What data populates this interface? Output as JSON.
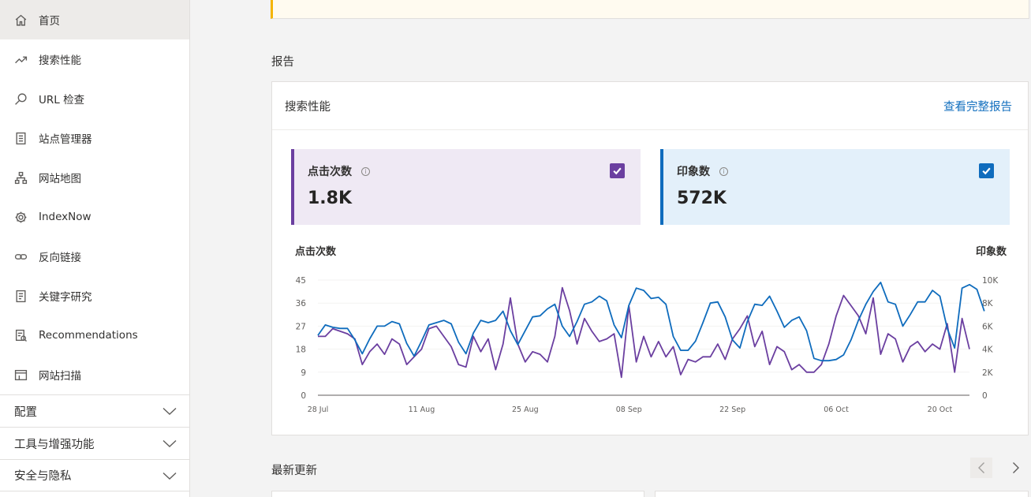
{
  "sidebar": {
    "items": [
      {
        "label": "首页",
        "icon": "home-icon"
      },
      {
        "label": "搜索性能",
        "icon": "trend-icon"
      },
      {
        "label": "URL 检查",
        "icon": "search-icon"
      },
      {
        "label": "站点管理器",
        "icon": "list-icon"
      },
      {
        "label": "网站地图",
        "icon": "sitemap-icon"
      },
      {
        "label": "IndexNow",
        "icon": "gear-icon"
      },
      {
        "label": "反向链接",
        "icon": "link-icon"
      },
      {
        "label": "关键字研究",
        "icon": "document-icon"
      },
      {
        "label": "Recommendations",
        "icon": "recommendation-icon"
      },
      {
        "label": "网站扫描",
        "icon": "scan-icon"
      }
    ],
    "sections": [
      {
        "label": "配置"
      },
      {
        "label": "工具与增强功能"
      },
      {
        "label": "安全与隐私"
      }
    ]
  },
  "reports": {
    "section_title": "报告",
    "card_title": "搜索性能",
    "card_link": "查看完整报告"
  },
  "metrics": {
    "clicks": {
      "label": "点击次数",
      "value": "1.8K",
      "color": "#6b3fa0"
    },
    "impressions": {
      "label": "印象数",
      "value": "572K",
      "color": "#0f6cbd"
    }
  },
  "latest_updates": {
    "title": "最新更新"
  },
  "chart_data": {
    "type": "line",
    "ylabel_left": "点击次数",
    "ylabel_right": "印象数",
    "y_left_ticks": [
      "45",
      "36",
      "27",
      "18",
      "9",
      "0"
    ],
    "y_right_ticks": [
      "10K",
      "8K",
      "6K",
      "4K",
      "2K",
      "0"
    ],
    "ylim_left": [
      0,
      45
    ],
    "ylim_right": [
      0,
      10000
    ],
    "x_ticks": [
      "28 Jul",
      "11 Aug",
      "25 Aug",
      "08 Sep",
      "22 Sep",
      "06 Oct",
      "20 Oct"
    ],
    "x_tick_index": [
      0,
      14,
      28,
      42,
      56,
      70,
      84
    ],
    "series": [
      {
        "name": "点击次数",
        "axis": "left",
        "color": "#6b3fa0",
        "values": [
          23,
          23,
          26,
          25,
          24,
          22,
          12,
          17,
          20,
          16,
          22,
          20,
          12,
          15,
          18,
          26,
          27,
          23,
          19,
          12,
          11,
          23,
          17,
          22,
          10,
          20,
          38,
          20,
          13,
          17,
          16,
          13,
          23,
          42,
          33,
          20,
          30,
          25,
          21,
          22,
          24,
          7,
          35,
          13,
          23,
          15,
          21,
          15,
          19,
          8,
          14,
          13,
          15,
          15,
          20,
          14,
          22,
          26,
          31,
          19,
          25,
          12,
          19,
          17,
          10,
          12,
          9,
          9,
          12,
          20,
          31,
          39,
          35,
          31,
          24,
          38,
          16,
          24,
          22,
          13,
          19,
          21,
          17,
          20,
          18,
          28,
          9,
          30,
          18
        ]
      },
      {
        "name": "印象数",
        "axis": "right",
        "color": "#0f6cbd",
        "values": [
          5.2,
          6.1,
          5.9,
          5.8,
          5.8,
          4.8,
          3.6,
          4.9,
          6.0,
          6.0,
          6.4,
          6.2,
          4.5,
          3.4,
          4.7,
          6.1,
          6.3,
          6.5,
          6.2,
          4.6,
          3.6,
          5.4,
          6.5,
          6.3,
          6.5,
          7.3,
          5.6,
          4.4,
          5.6,
          6.8,
          6.9,
          7.5,
          7.9,
          6.0,
          5.1,
          6.4,
          7.9,
          8.1,
          8.6,
          8.2,
          6.1,
          5.0,
          7.8,
          9.3,
          9.1,
          8.4,
          8.5,
          7.9,
          5.1,
          3.9,
          3.9,
          4.7,
          6.3,
          8.0,
          8.1,
          6.8,
          4.8,
          4.1,
          6.4,
          7.9,
          7.8,
          8.6,
          7.3,
          5.9,
          6.5,
          6.8,
          5.6,
          3.2,
          3.0,
          3.0,
          3.1,
          3.5,
          4.8,
          6.5,
          7.9,
          9.0,
          9.8,
          8.1,
          7.9,
          6.0,
          7.0,
          8.1,
          8.1,
          9.1,
          8.6,
          5.8,
          4.1,
          9.3,
          9.6,
          9.2,
          7.3
        ]
      }
    ]
  }
}
